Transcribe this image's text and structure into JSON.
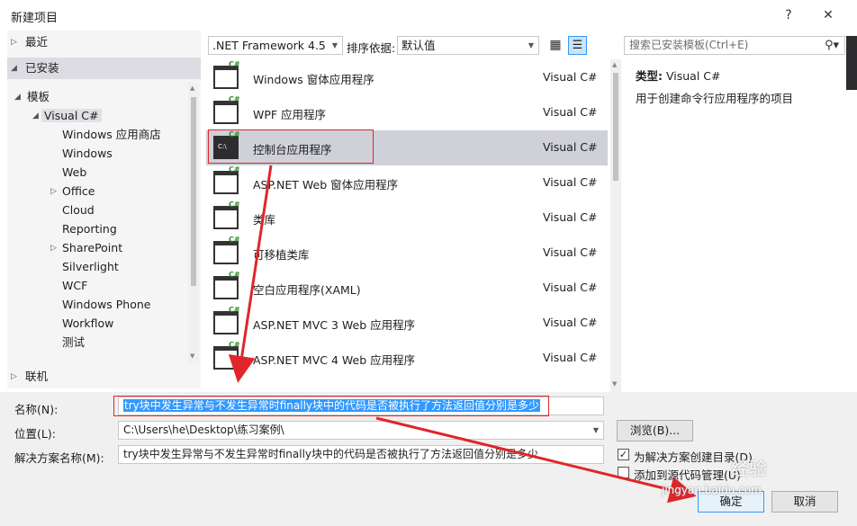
{
  "window": {
    "title": "新建项目",
    "help": "?",
    "close": "✕"
  },
  "tree": {
    "recent": "最近",
    "installed": "已安装",
    "templates": "模板",
    "visual_csharp": "Visual C#",
    "children": [
      "Windows 应用商店",
      "Windows",
      "Web",
      "Office",
      "Cloud",
      "Reporting",
      "SharePoint",
      "Silverlight",
      "WCF",
      "Windows Phone",
      "Workflow",
      "测试"
    ],
    "online": "联机"
  },
  "toolbar": {
    "framework": ".NET Framework 4.5",
    "sort_label": "排序依据:",
    "sort_value": "默认值",
    "search_placeholder": "搜索已安装模板(Ctrl+E)"
  },
  "templates": [
    {
      "name": "Windows 窗体应用程序",
      "lang": "Visual C#"
    },
    {
      "name": "WPF 应用程序",
      "lang": "Visual C#"
    },
    {
      "name": "控制台应用程序",
      "lang": "Visual C#"
    },
    {
      "name": "ASP.NET Web 窗体应用程序",
      "lang": "Visual C#"
    },
    {
      "name": "类库",
      "lang": "Visual C#"
    },
    {
      "name": "可移植类库",
      "lang": "Visual C#"
    },
    {
      "name": "空白应用程序(XAML)",
      "lang": "Visual C#"
    },
    {
      "name": "ASP.NET MVC 3 Web 应用程序",
      "lang": "Visual C#"
    },
    {
      "name": "ASP.NET MVC 4 Web 应用程序",
      "lang": "Visual C#"
    }
  ],
  "info": {
    "type_label": "类型:",
    "type_value": "Visual C#",
    "description": "用于创建命令行应用程序的项目"
  },
  "form": {
    "name_label": "名称(N):",
    "name_value": "try块中发生异常与不发生异常时finally块中的代码是否被执行了方法返回值分别是多少",
    "location_label": "位置(L):",
    "location_value": "C:\\Users\\he\\Desktop\\练习案例\\",
    "solution_label": "解决方案名称(M):",
    "solution_value": "try块中发生异常与不发生异常时finally块中的代码是否被执行了方法返回值分别是多少",
    "browse": "浏览(B)...",
    "create_dir": "为解决方案创建目录(D)",
    "add_source": "添加到源代码管理(U)",
    "ok": "确定",
    "cancel": "取消"
  },
  "watermark": {
    "text": "经验",
    "sub": "jingyan.baidu.com"
  },
  "colors": {
    "annotation_red": "#e0262a",
    "selection": "#cfd0d8",
    "csharp_green": "#2b8a2b"
  }
}
